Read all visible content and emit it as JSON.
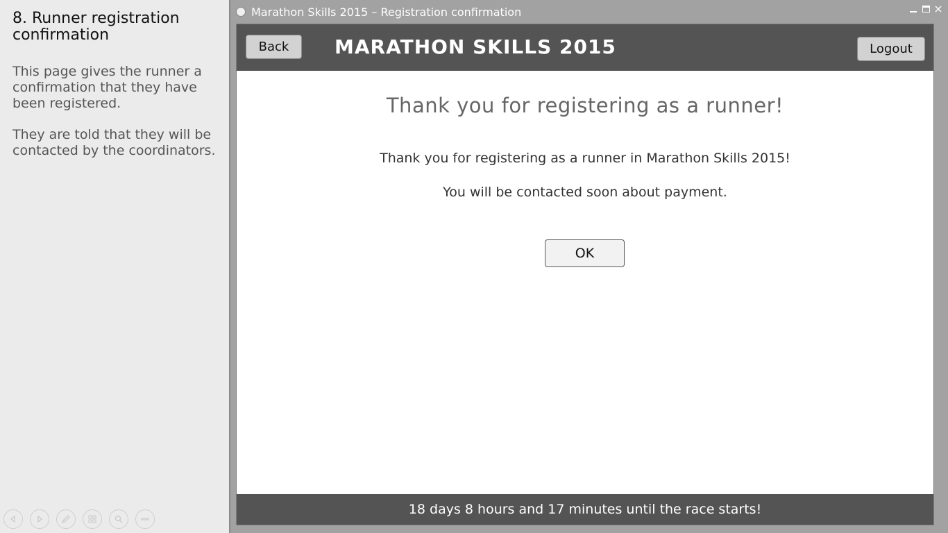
{
  "notes": {
    "title": "8. Runner registration confirmation",
    "paragraphs": [
      "This page gives the runner a confirmation that they have been registered.",
      "They are told that they will be contacted by the coordinators."
    ],
    "controls": [
      "previous-slide-icon",
      "next-slide-icon",
      "pen-icon",
      "slides-grid-icon",
      "zoom-icon",
      "more-options-icon"
    ]
  },
  "window": {
    "title": "Marathon Skills 2015 – Registration confirmation",
    "controls": [
      "minimize-icon",
      "maximize-icon",
      "close-icon"
    ]
  },
  "header": {
    "back_label": "Back",
    "app_title": "MARATHON SKILLS 2015",
    "logout_label": "Logout"
  },
  "main": {
    "headline": "Thank you for registering as a runner!",
    "line1": "Thank you for registering as a runner in Marathon Skills 2015!",
    "line2": "You will be contacted soon about payment.",
    "ok_label": "OK"
  },
  "footer": {
    "countdown": "18 days 8 hours and 17 minutes until the race starts!"
  },
  "colors": {
    "header_bg": "#545454",
    "footer_bg": "#545454",
    "window_chrome": "#a2a2a2",
    "notes_bg": "#ebebeb"
  }
}
